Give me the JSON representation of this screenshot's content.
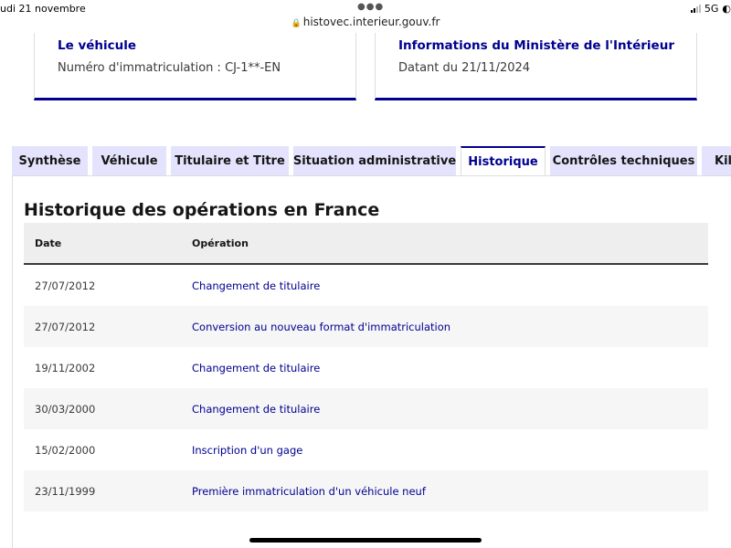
{
  "status_bar": {
    "time": "udi 21 novembre",
    "url": "histovec.interieur.gouv.fr",
    "network": "5G"
  },
  "cards": {
    "vehicle": {
      "title": "Le véhicule",
      "text": "Numéro d'immatriculation : CJ-1**-EN"
    },
    "ministry": {
      "title": "Informations du Ministère de l'Intérieur",
      "text": "Datant du 21/11/2024"
    }
  },
  "tabs": [
    {
      "label": "Synthèse",
      "active": false
    },
    {
      "label": "Véhicule",
      "active": false
    },
    {
      "label": "Titulaire et Titre",
      "active": false
    },
    {
      "label": "Situation administrative",
      "active": false
    },
    {
      "label": "Historique",
      "active": true
    },
    {
      "label": "Contrôles techniques",
      "active": false
    },
    {
      "label": "Kilo",
      "active": false
    }
  ],
  "section": {
    "title": "Historique des opérations en France"
  },
  "table": {
    "headers": {
      "date": "Date",
      "operation": "Opération"
    },
    "rows": [
      {
        "date": "27/07/2012",
        "operation": "Changement de titulaire"
      },
      {
        "date": "27/07/2012",
        "operation": "Conversion au nouveau format d'immatriculation"
      },
      {
        "date": "19/11/2002",
        "operation": "Changement de titulaire"
      },
      {
        "date": "30/03/2000",
        "operation": "Changement de titulaire"
      },
      {
        "date": "15/02/2000",
        "operation": "Inscription d'un gage"
      },
      {
        "date": "23/11/1999",
        "operation": "Première immatriculation d'un véhicule neuf"
      }
    ]
  },
  "colors": {
    "accent": "#000091",
    "tab_bg": "#e3e3fd",
    "row_alt": "#f6f6f6"
  },
  "icons": {
    "lock": "lock-icon",
    "signal": "signal-icon",
    "more": "more-dots-icon"
  }
}
